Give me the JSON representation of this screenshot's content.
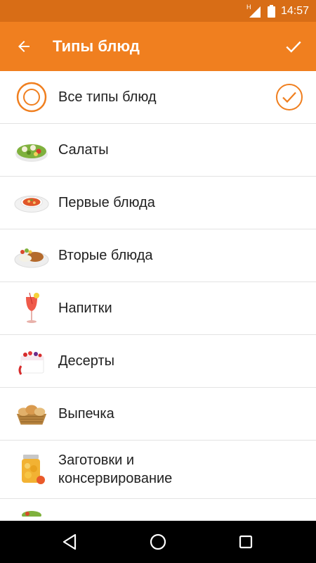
{
  "status_bar": {
    "network_letter": "H",
    "time": "14:57"
  },
  "app_bar": {
    "title": "Типы блюд",
    "back_icon": "arrow-left-icon",
    "confirm_icon": "check-icon"
  },
  "colors": {
    "status_bar": "#d86d16",
    "app_bar": "#f07f1f",
    "accent": "#f07f1f",
    "divider": "#e3e3e3"
  },
  "list": {
    "items": [
      {
        "label": "Все типы блюд",
        "icon": "all-types-ring-icon",
        "selected": true
      },
      {
        "label": "Салаты",
        "icon": "salad-icon",
        "selected": false
      },
      {
        "label": "Первые блюда",
        "icon": "soup-icon",
        "selected": false
      },
      {
        "label": "Вторые блюда",
        "icon": "main-course-icon",
        "selected": false
      },
      {
        "label": "Напитки",
        "icon": "drink-icon",
        "selected": false
      },
      {
        "label": "Десерты",
        "icon": "dessert-icon",
        "selected": false
      },
      {
        "label": "Выпечка",
        "icon": "pastry-basket-icon",
        "selected": false
      },
      {
        "label": "Заготовки и\nконсервирование",
        "icon": "preserves-jar-icon",
        "selected": false
      }
    ]
  },
  "nav_bar": {
    "back": "nav-back-icon",
    "home": "nav-home-icon",
    "recents": "nav-recents-icon"
  }
}
